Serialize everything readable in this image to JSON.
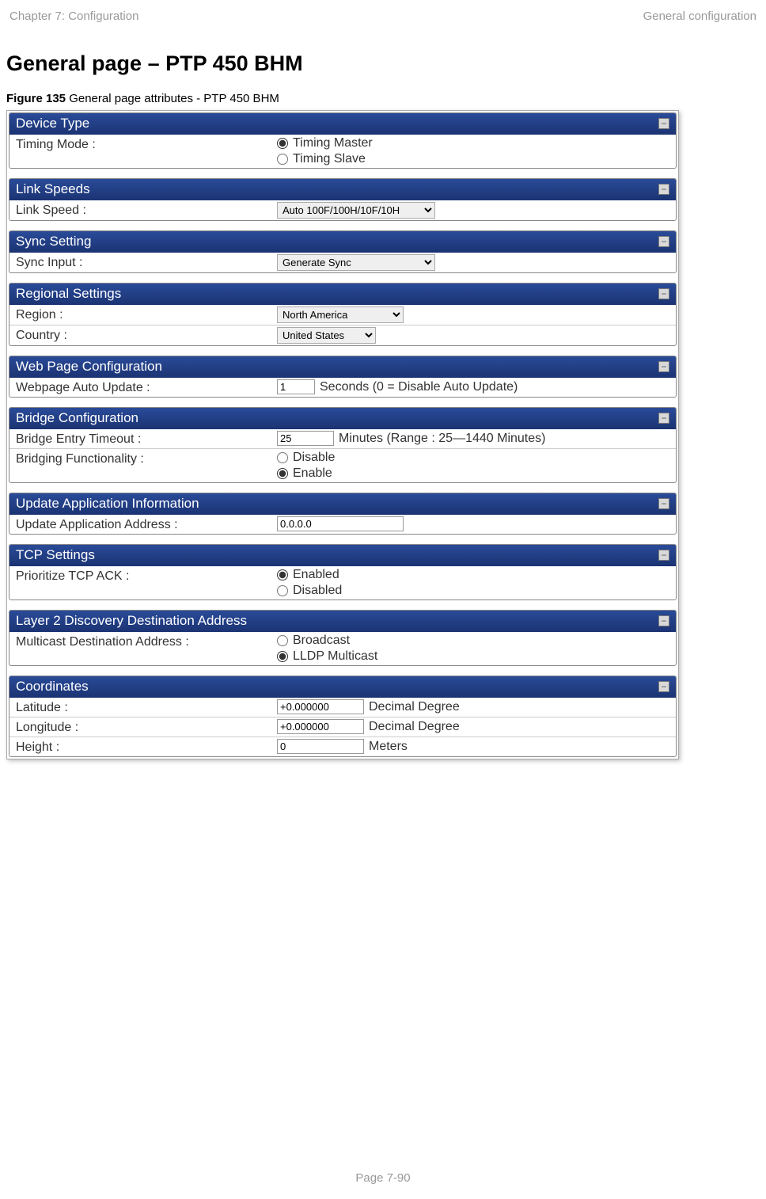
{
  "header": {
    "left": "Chapter 7:  Configuration",
    "right": "General configuration"
  },
  "title": "General page – PTP 450 BHM",
  "figure": {
    "label": "Figure 135",
    "caption": " General page attributes - PTP 450 BHM"
  },
  "panels": {
    "deviceType": {
      "title": "Device Type",
      "timingMode": {
        "label": "Timing Mode :",
        "options": [
          "Timing Master",
          "Timing Slave"
        ],
        "selected": "Timing Master"
      }
    },
    "linkSpeeds": {
      "title": "Link Speeds",
      "linkSpeed": {
        "label": "Link Speed :",
        "value": "Auto 100F/100H/10F/10H"
      }
    },
    "syncSetting": {
      "title": "Sync Setting",
      "syncInput": {
        "label": "Sync Input :",
        "value": "Generate Sync"
      }
    },
    "regional": {
      "title": "Regional Settings",
      "region": {
        "label": "Region :",
        "value": "North America"
      },
      "country": {
        "label": "Country :",
        "value": "United States"
      }
    },
    "webPage": {
      "title": "Web Page Configuration",
      "autoUpdate": {
        "label": "Webpage Auto Update :",
        "value": "1",
        "suffix": "Seconds (0 = Disable Auto Update)"
      }
    },
    "bridge": {
      "title": "Bridge Configuration",
      "timeout": {
        "label": "Bridge Entry Timeout :",
        "value": "25",
        "suffix": "Minutes (Range : 25—1440 Minutes)"
      },
      "functionality": {
        "label": "Bridging Functionality :",
        "options": [
          "Disable",
          "Enable"
        ],
        "selected": "Enable"
      }
    },
    "updateApp": {
      "title": "Update Application Information",
      "address": {
        "label": "Update Application Address :",
        "value": "0.0.0.0"
      }
    },
    "tcp": {
      "title": "TCP Settings",
      "prioritize": {
        "label": "Prioritize TCP ACK :",
        "options": [
          "Enabled",
          "Disabled"
        ],
        "selected": "Enabled"
      }
    },
    "layer2": {
      "title": "Layer 2 Discovery Destination Address",
      "multicast": {
        "label": "Multicast Destination Address :",
        "options": [
          "Broadcast",
          "LLDP Multicast"
        ],
        "selected": "LLDP Multicast"
      }
    },
    "coordinates": {
      "title": "Coordinates",
      "latitude": {
        "label": "Latitude :",
        "value": "+0.000000",
        "suffix": "Decimal Degree"
      },
      "longitude": {
        "label": "Longitude :",
        "value": "+0.000000",
        "suffix": "Decimal Degree"
      },
      "height": {
        "label": "Height :",
        "value": "0",
        "suffix": "Meters"
      }
    }
  },
  "footer": "Page 7-90"
}
